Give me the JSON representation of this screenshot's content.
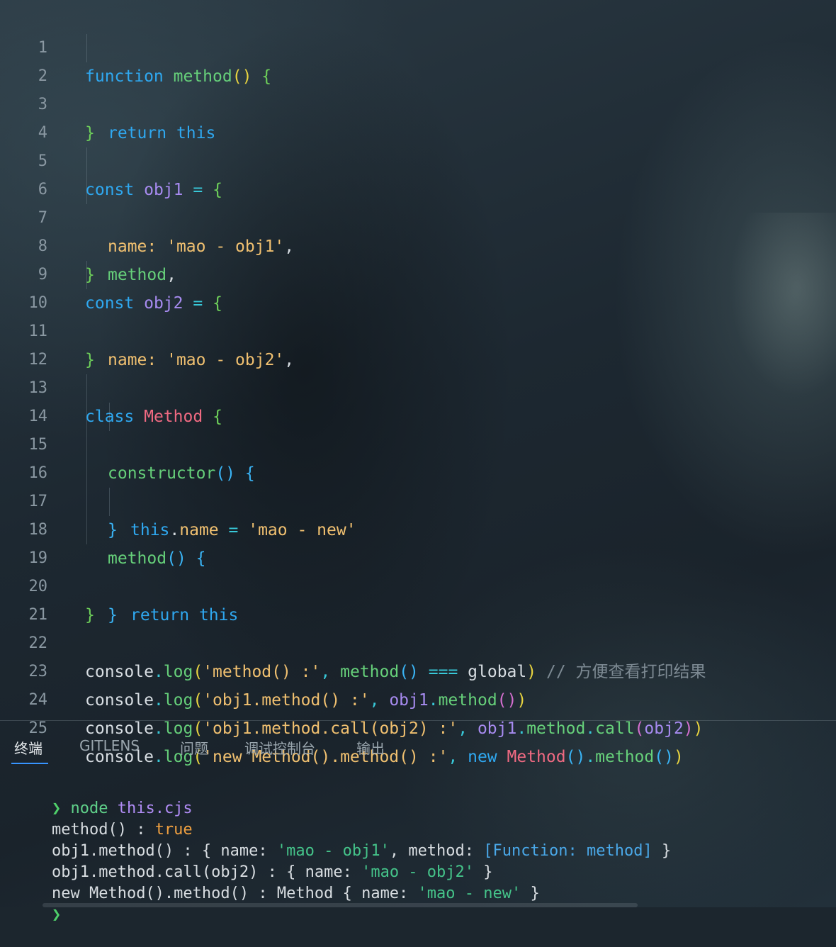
{
  "editor": {
    "line_numbers": [
      "1",
      "2",
      "3",
      "4",
      "5",
      "6",
      "7",
      "8",
      "9",
      "10",
      "11",
      "12",
      "13",
      "14",
      "15",
      "16",
      "17",
      "18",
      "19",
      "20",
      "21",
      "22",
      "23",
      "24",
      "25"
    ],
    "comment_22": "// 方便查看打印结果",
    "strings": {
      "s6": "'mao - obj1'",
      "s10": "'mao - obj2'",
      "s15": "'mao - new'",
      "s22": "'method() :'",
      "s23": "'obj1.method() :'",
      "s24": "'obj1.method.call(obj2) :'",
      "s25": "'new Method().method() :'"
    },
    "tokens": {
      "function": "function",
      "method": "method",
      "return": "return",
      "this": "this",
      "const": "const",
      "obj1": "obj1",
      "obj2": "obj2",
      "name": "name",
      "class": "class",
      "Method": "Method",
      "constructor": "constructor",
      "console": "console",
      "log": "log",
      "global": "global",
      "call": "call",
      "new": "new"
    }
  },
  "panel": {
    "tabs": [
      {
        "label": "终端",
        "active": true
      },
      {
        "label": "GITLENS",
        "active": false
      },
      {
        "label": "问题",
        "active": false
      },
      {
        "label": "调试控制台",
        "active": false
      },
      {
        "label": "输出",
        "active": false
      }
    ]
  },
  "terminal": {
    "prompt": "❯",
    "command": "node",
    "file": "this.cjs",
    "out1_label": "method() : ",
    "out1_value": "true",
    "out2_label": "obj1.method() : { name: ",
    "out2_str": "'mao - obj1'",
    "out2_mid": ", method: ",
    "out2_fn": "[Function: method]",
    "out2_end": " }",
    "out3_label": "obj1.method.call(obj2) : { name: ",
    "out3_str": "'mao - obj2'",
    "out3_end": " }",
    "out4_label": "new Method().method() : Method { name: ",
    "out4_str": "'mao - new'",
    "out4_end": " }"
  }
}
